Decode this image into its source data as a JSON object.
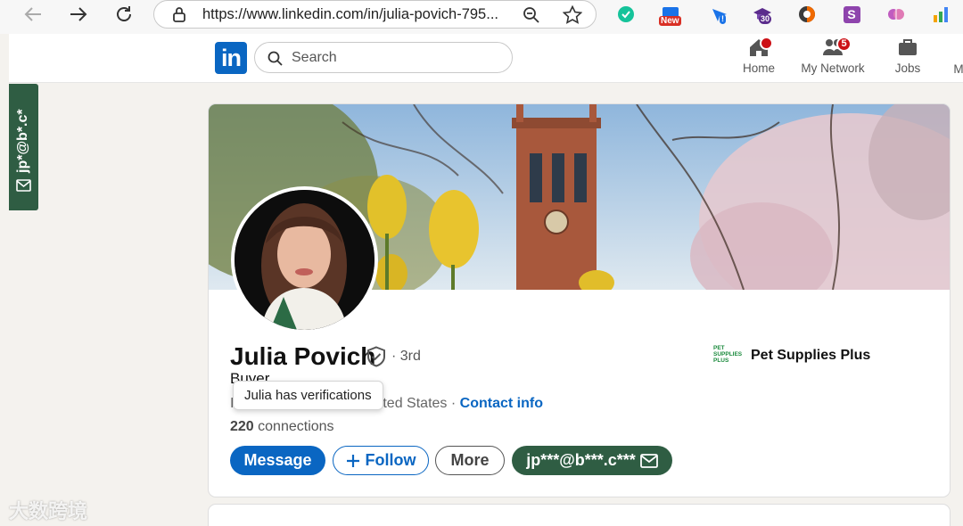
{
  "browser": {
    "url": "https://www.linkedin.com/in/julia-povich-795...",
    "extensions": [
      {
        "name": "grammarly-icon",
        "color": "#15c39a"
      },
      {
        "name": "new-extension-icon",
        "badge": "New",
        "color": "#d93025"
      },
      {
        "name": "notify-extension-icon",
        "badge": "!",
        "color": "#1a73e8"
      },
      {
        "name": "grad-cap-icon",
        "badge": "30",
        "color": "#5b2c8c"
      },
      {
        "name": "dark-circle-icon",
        "color": "#3b3b3b"
      },
      {
        "name": "s-extension-icon",
        "letter": "S",
        "color": "#8e44ad"
      },
      {
        "name": "brain-icon",
        "color": "#c05cc0"
      },
      {
        "name": "bars-chart-icon",
        "color": "#f4a300"
      }
    ]
  },
  "linkedin_nav": {
    "search_placeholder": "Search",
    "items": [
      {
        "label": "Home",
        "badge": ""
      },
      {
        "label": "My Network",
        "badge": "5"
      },
      {
        "label": "Jobs",
        "badge": ""
      },
      {
        "label": "M",
        "badge": ""
      }
    ]
  },
  "side_tab": {
    "text": "jp*@b*.c*"
  },
  "profile": {
    "name": "Julia Povich",
    "degree": "· 3rd",
    "headline": "Buyer",
    "location_visible": "ted States ·",
    "location_prefix": "I",
    "contact_info": "Contact info",
    "tooltip": "Julia has verifications",
    "connections_count": "220",
    "connections_label": "connections",
    "company": {
      "name": "Pet Supplies Plus",
      "logo_text": [
        "PET",
        "SUPPLIES",
        "PLUS"
      ]
    },
    "buttons": {
      "message": "Message",
      "follow": "Follow",
      "more": "More",
      "email": "jp***@b***.c***"
    }
  },
  "watermark": "大数跨境",
  "colors": {
    "linkedin_blue": "#0a66c2",
    "email_green": "#2f5d43",
    "notification_red": "#cc1016"
  }
}
